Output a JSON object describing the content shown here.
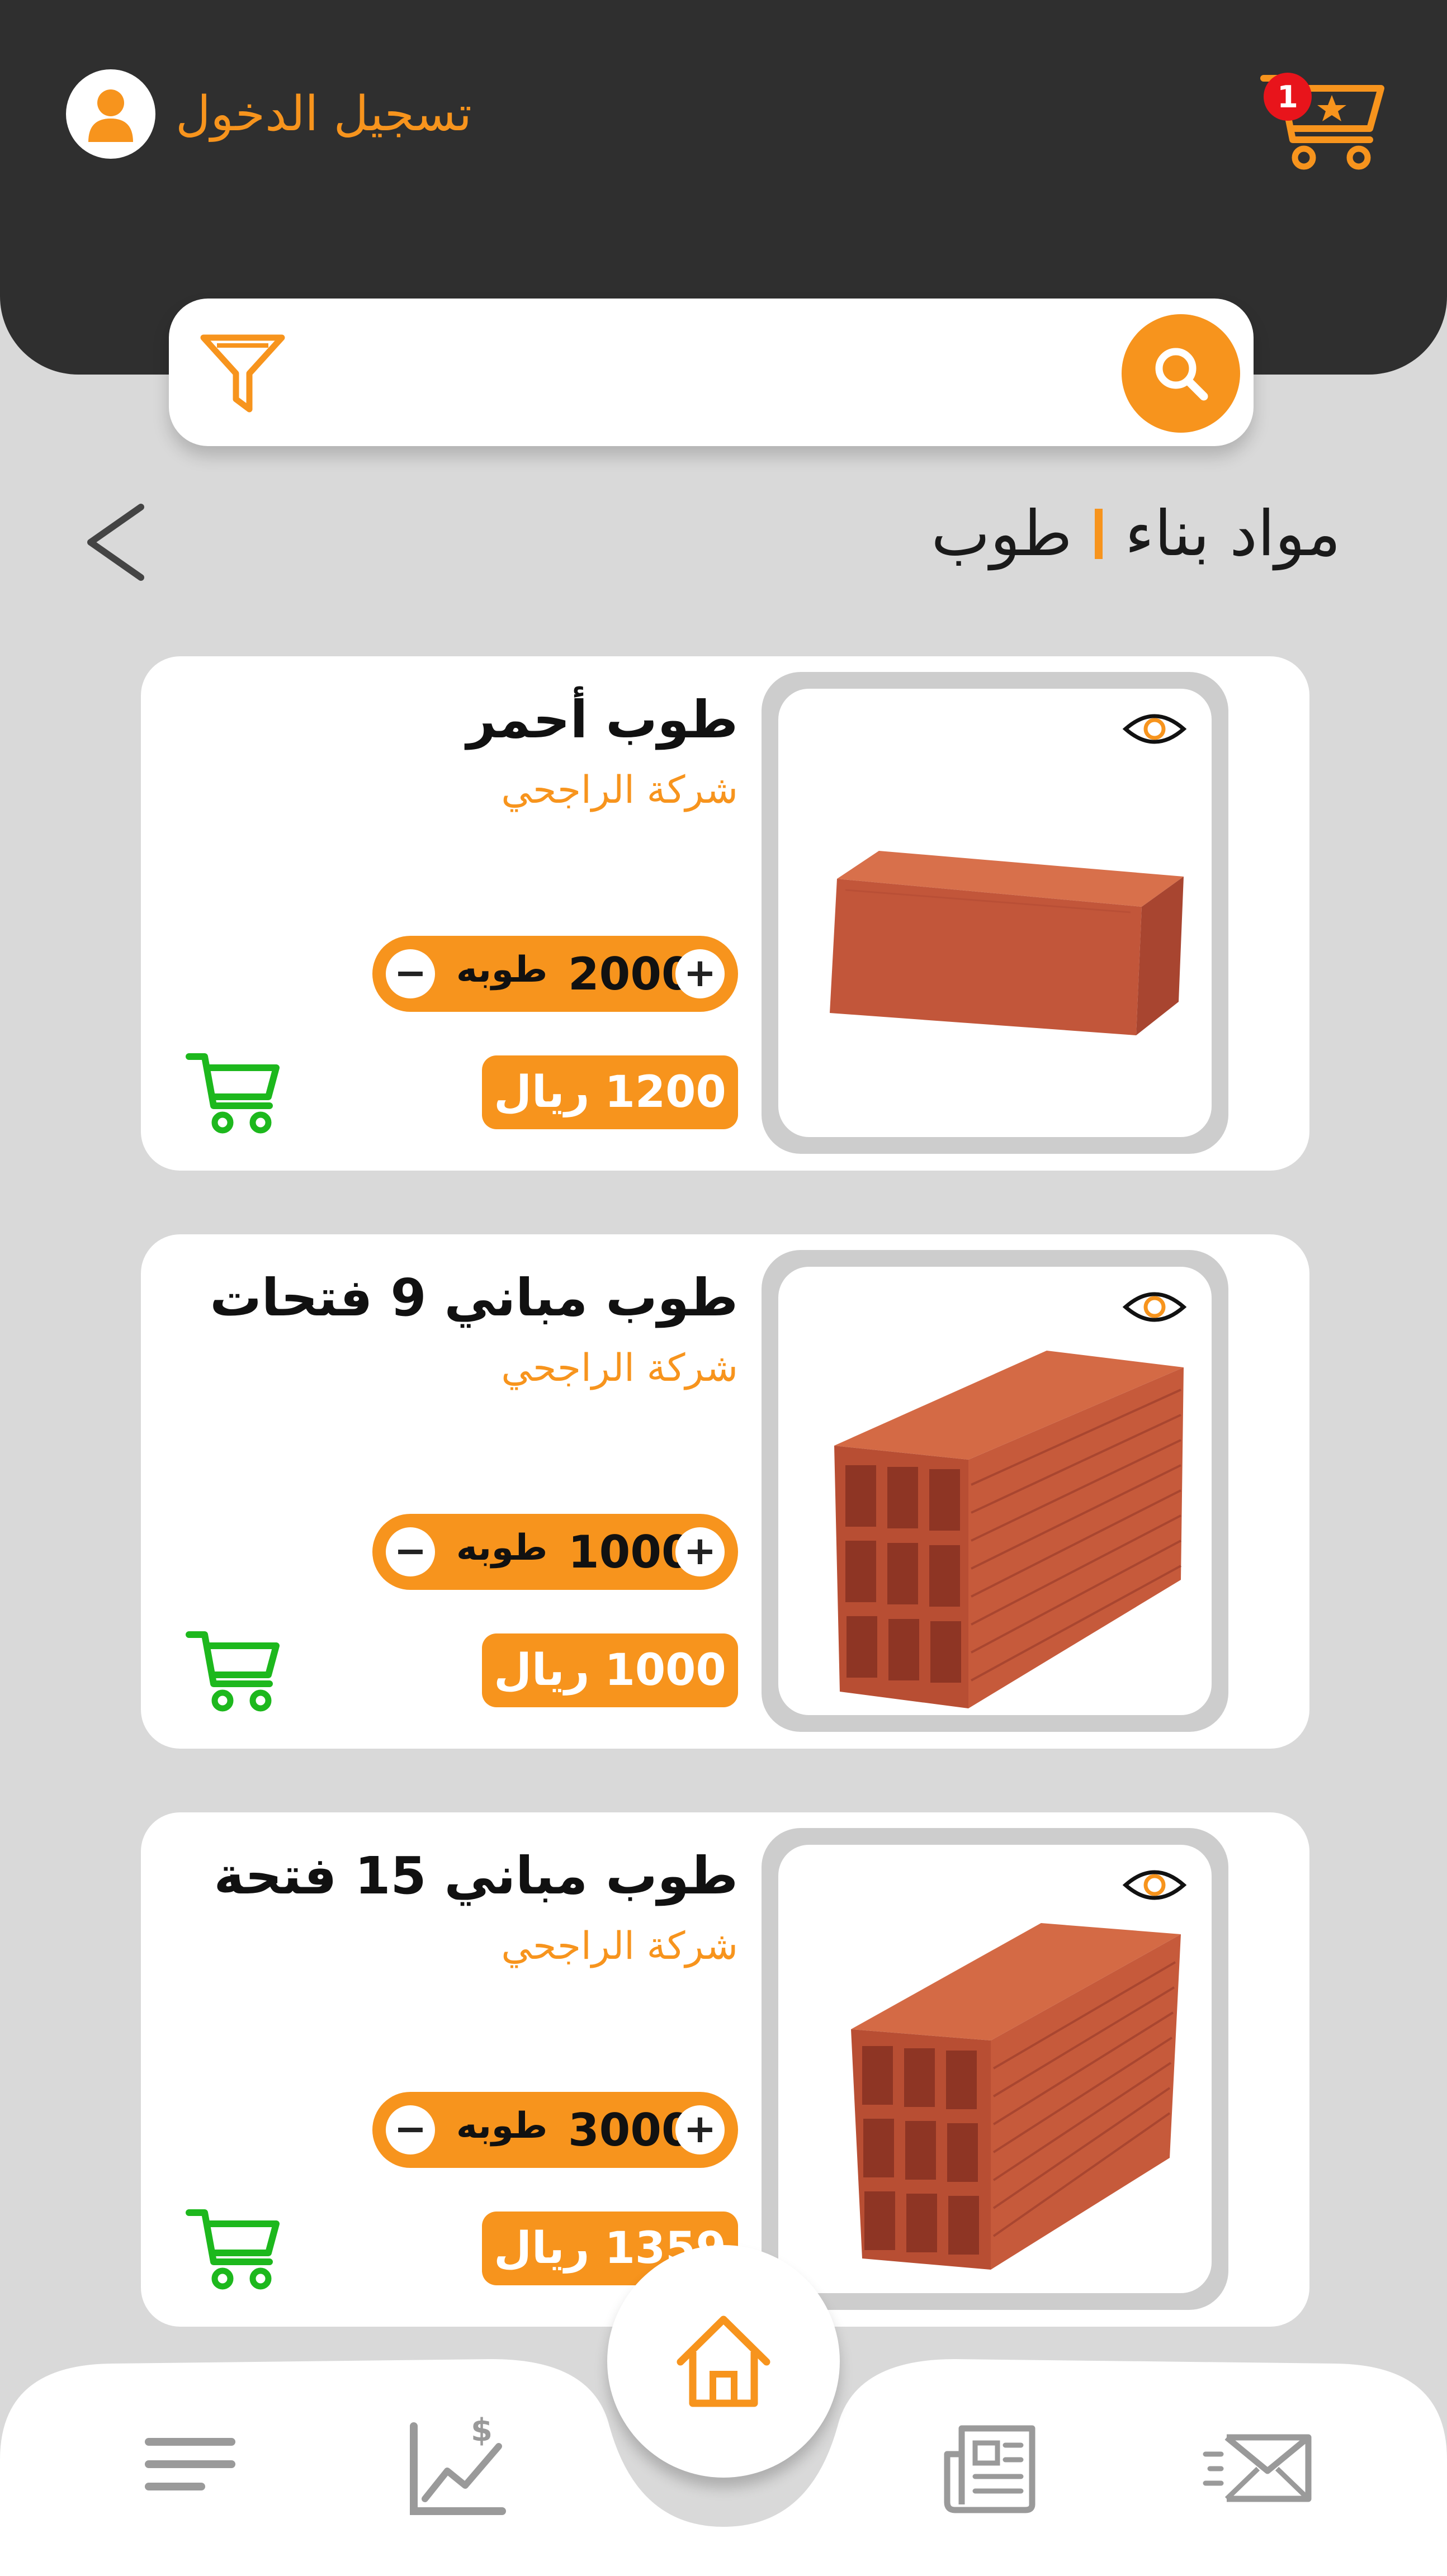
{
  "header": {
    "login_label": "تسجيل الدخول",
    "cart_count": "1"
  },
  "search": {
    "placeholder": ""
  },
  "breadcrumb": {
    "category": "مواد بناء",
    "subcategory": "طوب"
  },
  "products": [
    {
      "title": "طوب أحمر",
      "company": "شركة الراجحي",
      "quantity": "2000",
      "unit": "طوبه",
      "price": "1200 ريال",
      "image": "solid-red-brick"
    },
    {
      "title": "طوب مباني 9 فتحات",
      "company": "شركة الراجحي",
      "quantity": "1000",
      "unit": "طوبه",
      "price": "1000 ريال",
      "image": "hollow-brick-9-holes"
    },
    {
      "title": "طوب مباني 15 فتحة",
      "company": "شركة الراجحي",
      "quantity": "3000",
      "unit": "طوبه",
      "price": "1359 ريال",
      "image": "hollow-brick-15-holes"
    }
  ],
  "qty_controls": {
    "minus": "−",
    "plus": "+"
  },
  "bottom_nav": [
    "menu-icon",
    "stats-icon",
    "home-icon",
    "news-icon",
    "mail-icon"
  ],
  "colors": {
    "accent": "#f7941d",
    "header": "#2f2f2f",
    "background": "#d9d9d9",
    "cart_green": "#1db81d",
    "badge": "#e8141b",
    "nav_icons": "#9a9a9a"
  }
}
